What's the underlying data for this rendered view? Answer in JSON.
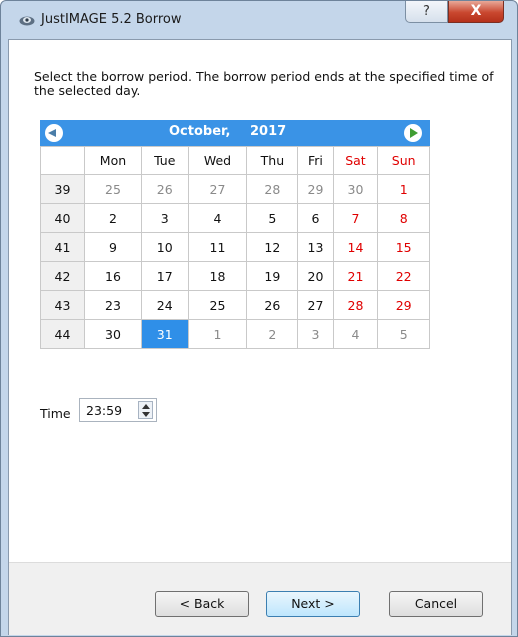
{
  "window": {
    "title": "JustIMAGE 5.2 Borrow",
    "help_label": "?",
    "close_label": "X"
  },
  "instructions": "Select the borrow period. The borrow period ends at the specified time of the selected day.",
  "calendar": {
    "month": "October,",
    "year": "2017",
    "weekday_headers": [
      "Mon",
      "Tue",
      "Wed",
      "Thu",
      "Fri",
      "Sat",
      "Sun"
    ],
    "weeks": [
      {
        "week": "39",
        "days": [
          "25",
          "26",
          "27",
          "28",
          "29",
          "30",
          "1"
        ]
      },
      {
        "week": "40",
        "days": [
          "2",
          "3",
          "4",
          "5",
          "6",
          "7",
          "8"
        ]
      },
      {
        "week": "41",
        "days": [
          "9",
          "10",
          "11",
          "12",
          "13",
          "14",
          "15"
        ]
      },
      {
        "week": "42",
        "days": [
          "16",
          "17",
          "18",
          "19",
          "20",
          "21",
          "22"
        ]
      },
      {
        "week": "43",
        "days": [
          "23",
          "24",
          "25",
          "26",
          "27",
          "28",
          "29"
        ]
      },
      {
        "week": "44",
        "days": [
          "30",
          "31",
          "1",
          "2",
          "3",
          "4",
          "5"
        ]
      }
    ],
    "selected_day": "31",
    "colors": {
      "nav_bar": "#3a93e6",
      "selected": "#2f8fe8",
      "weekend": "#e00000",
      "other_month": "#8a8a8a"
    }
  },
  "time": {
    "label": "Time",
    "value": "23:59"
  },
  "buttons": {
    "back": "< Back",
    "next": "Next >",
    "cancel": "Cancel"
  }
}
